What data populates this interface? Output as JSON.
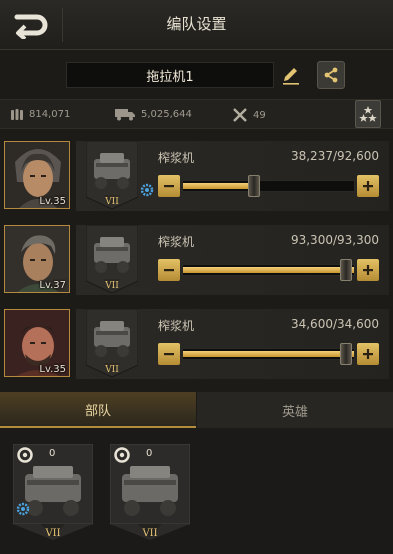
{
  "header": {
    "title": "编队设置"
  },
  "formation": {
    "name": "拖拉机1"
  },
  "stats": {
    "power": "814,071",
    "load": "5,025,644",
    "repair": "49"
  },
  "colors": {
    "accent": "#c8962f",
    "accent_light": "#f4d07a",
    "background": "#1c1b18"
  },
  "troops": [
    {
      "hero_level": "Lv.35",
      "unit_name": "榨浆机",
      "unit_tier": "VII",
      "count": "38,237/92,600",
      "fill_fraction": 0.413,
      "has_gear": true
    },
    {
      "hero_level": "Lv.37",
      "unit_name": "榨浆机",
      "unit_tier": "VII",
      "count": "93,300/93,300",
      "fill_fraction": 1.0,
      "has_gear": false
    },
    {
      "hero_level": "Lv.35",
      "unit_name": "榨浆机",
      "unit_tier": "VII",
      "count": "34,600/34,600",
      "fill_fraction": 1.0,
      "has_gear": false
    }
  ],
  "tabs": [
    {
      "label": "部队",
      "active": true
    },
    {
      "label": "英雄",
      "active": false
    }
  ],
  "reserve": [
    {
      "count": "0",
      "tier": "VII",
      "has_gear": true
    },
    {
      "count": "0",
      "tier": "VII",
      "has_gear": false
    }
  ],
  "icons": [
    "back-arrow-icon",
    "pencil-icon",
    "share-icon",
    "bullets-icon",
    "truck-icon",
    "wrench-icon",
    "stars-icon",
    "gear-icon",
    "tire-icon",
    "minus-icon",
    "plus-icon"
  ]
}
